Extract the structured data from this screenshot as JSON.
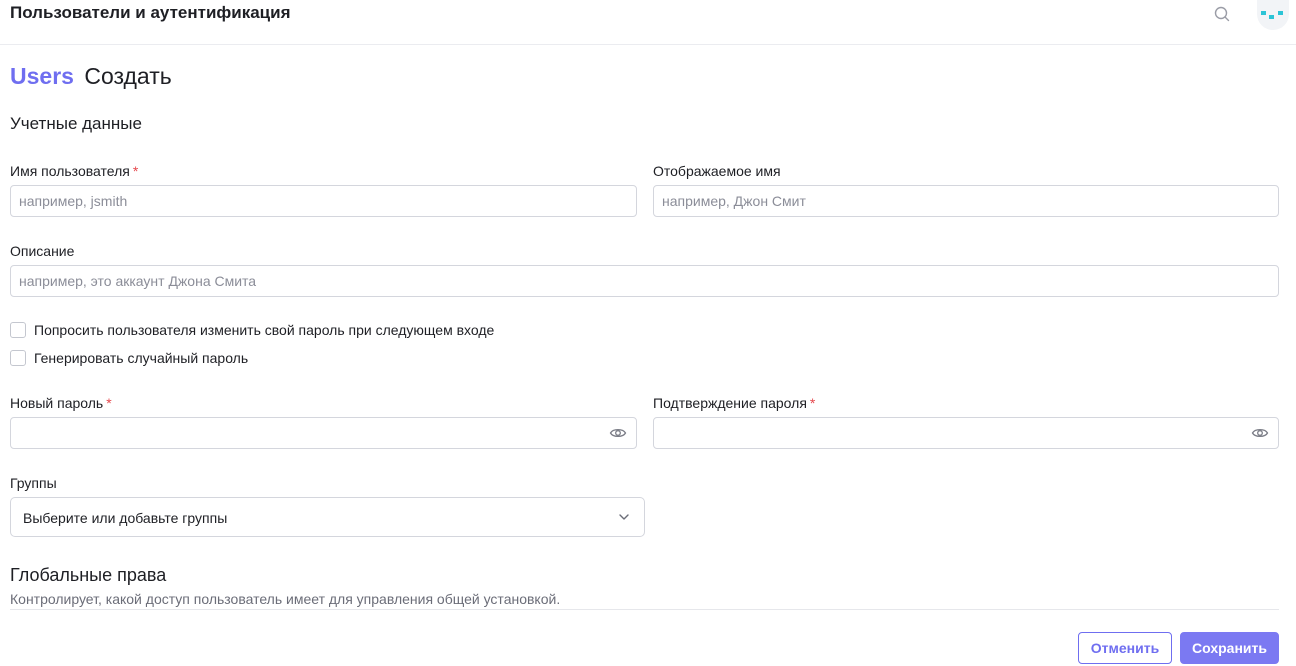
{
  "header": {
    "title": "Пользователи и аутентификация",
    "icons": [
      "search-icon",
      "user-avatar"
    ]
  },
  "breadcrumb": {
    "link": "Users",
    "current": "Создать"
  },
  "form": {
    "section_title": "Учетные данные",
    "username": {
      "label": "Имя пользователя",
      "required_mark": "*",
      "placeholder": "например, jsmith",
      "value": ""
    },
    "display_name": {
      "label": "Отображаемое имя",
      "placeholder": "например, Джон Смит",
      "value": ""
    },
    "description": {
      "label": "Описание",
      "placeholder": "например, это аккаунт Джона Смита",
      "value": ""
    },
    "checkboxes": [
      {
        "label": "Попросить пользователя изменить свой пароль при следующем входе",
        "checked": false
      },
      {
        "label": "Генерировать случайный пароль",
        "checked": false
      }
    ],
    "new_password": {
      "label": "Новый пароль",
      "required_mark": "*",
      "value": ""
    },
    "confirm_password": {
      "label": "Подтверждение пароля",
      "required_mark": "*",
      "value": ""
    },
    "groups": {
      "label": "Группы",
      "selected": "Выберите или добавьте группы"
    }
  },
  "global_permissions": {
    "title": "Глобальные права",
    "description": "Контролирует, какой доступ пользователь имеет для управления общей установкой."
  },
  "actions": {
    "cancel": "Отменить",
    "save": "Сохранить"
  },
  "colors": {
    "accent": "#6f6ef0",
    "primary_button": "#7b79f2",
    "required": "#e5484d",
    "avatar_teal": "#2cc4d6"
  }
}
